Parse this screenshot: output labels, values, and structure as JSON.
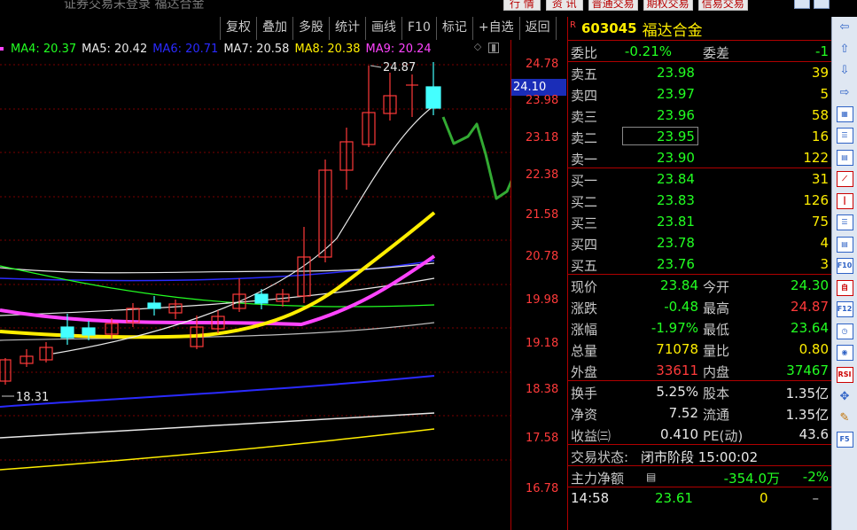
{
  "window": {
    "title": "证券交易未登录  福达合金",
    "top_buttons": [
      "行 情",
      "资 讯",
      "普通交易",
      "期权交易",
      "信易交易"
    ]
  },
  "toolbar": {
    "items": [
      "复权",
      "叠加",
      "多股",
      "统计",
      "画线",
      "F10",
      "标记",
      "+自选",
      "返回"
    ]
  },
  "ma_legend": [
    {
      "label": "MA4: 20.37",
      "color": "#22ff22"
    },
    {
      "label": "MA5: 20.42",
      "color": "#e8e8e8"
    },
    {
      "label": "MA6: 20.71",
      "color": "#2a2aff"
    },
    {
      "label": "MA7: 20.58",
      "color": "#e8e8e8"
    },
    {
      "label": "MA8: 20.38",
      "color": "#ffee00"
    },
    {
      "label": "MA9: 20.24",
      "color": "#ff44ff"
    }
  ],
  "price_axis": {
    "current": "24.10",
    "ticks": [
      "24.78",
      "23.98",
      "23.18",
      "22.38",
      "21.58",
      "20.78",
      "19.98",
      "19.18",
      "18.38",
      "17.58",
      "16.78"
    ]
  },
  "annotations": {
    "high": "24.87",
    "low": "18.31"
  },
  "stock": {
    "code": "603045",
    "name": "福达合金",
    "marker": "R"
  },
  "quote": {
    "weibi_label": "委比",
    "weibi": "-0.21%",
    "weicha_label": "委差",
    "weicha": "-1",
    "asks": [
      {
        "label": "卖五",
        "price": "23.98",
        "vol": "39"
      },
      {
        "label": "卖四",
        "price": "23.97",
        "vol": "5"
      },
      {
        "label": "卖三",
        "price": "23.96",
        "vol": "58"
      },
      {
        "label": "卖二",
        "price": "23.95",
        "vol": "16"
      },
      {
        "label": "卖一",
        "price": "23.90",
        "vol": "122"
      }
    ],
    "bids": [
      {
        "label": "买一",
        "price": "23.84",
        "vol": "31"
      },
      {
        "label": "买二",
        "price": "23.83",
        "vol": "126"
      },
      {
        "label": "买三",
        "price": "23.81",
        "vol": "75"
      },
      {
        "label": "买四",
        "price": "23.78",
        "vol": "4"
      },
      {
        "label": "买五",
        "price": "23.76",
        "vol": "3"
      }
    ],
    "stats": [
      {
        "l1": "现价",
        "v1": "23.84",
        "c1": "dn",
        "l2": "今开",
        "v2": "24.30",
        "c2": "dn"
      },
      {
        "l1": "涨跌",
        "v1": "-0.48",
        "c1": "dn",
        "l2": "最高",
        "v2": "24.87",
        "c2": "up"
      },
      {
        "l1": "涨幅",
        "v1": "-1.97%",
        "c1": "dn",
        "l2": "最低",
        "v2": "23.64",
        "c2": "dn"
      },
      {
        "l1": "总量",
        "v1": "71078",
        "c1": "yl",
        "l2": "量比",
        "v2": "0.80",
        "c2": "yl"
      },
      {
        "l1": "外盘",
        "v1": "33611",
        "c1": "up",
        "l2": "内盘",
        "v2": "37467",
        "c2": "dn"
      }
    ],
    "fin": [
      {
        "l1": "换手",
        "v1": "5.25%",
        "l2": "股本",
        "v2": "1.35亿"
      },
      {
        "l1": "净资",
        "v1": "7.52",
        "l2": "流通",
        "v2": "1.35亿"
      },
      {
        "l1": "收益㈢",
        "v1": "0.410",
        "l2": "PE(动)",
        "v2": "43.6"
      }
    ],
    "status_label": "交易状态:",
    "status": "闭市阶段 15:00:02",
    "flow_label": "主力净额",
    "flow": "-354.0万",
    "flow_pct": "-2%",
    "tick": {
      "time": "14:58",
      "price": "23.61",
      "vol": "0",
      "dir": "–"
    }
  },
  "colors": {
    "up": "#ff3a3a",
    "down": "#22ff22",
    "accent": "#ffee00",
    "axis": "#b00000"
  },
  "side_icons": [
    "arrow-left-icon",
    "arrow-up-icon",
    "arrow-down-icon",
    "arrow-right-icon",
    "table-icon",
    "list-icon",
    "grid-icon",
    "tick-chart-icon",
    "kline-icon",
    "indicator-icon",
    "report-icon",
    "f10-icon",
    "box-icon",
    "f12-icon",
    "clock-icon",
    "search-icon",
    "rsi-icon",
    "move-icon",
    "pencil-icon",
    "f5-icon"
  ]
}
